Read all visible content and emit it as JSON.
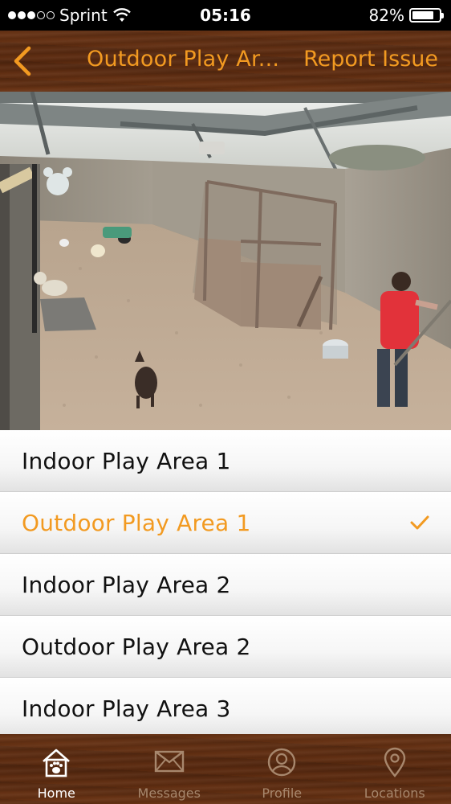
{
  "status_bar": {
    "carrier": "Sprint",
    "time": "05:16",
    "battery": "82%",
    "battery_level": 0.82
  },
  "nav": {
    "title": "Outdoor Play Ar...",
    "report_label": "Report Issue",
    "accent_color": "#f29a21"
  },
  "areas": [
    {
      "label": "Indoor Play Area 1",
      "selected": false
    },
    {
      "label": "Outdoor Play Area 1",
      "selected": true
    },
    {
      "label": "Indoor Play Area 2",
      "selected": false
    },
    {
      "label": "Outdoor Play Area 2",
      "selected": false
    },
    {
      "label": "Indoor Play Area 3",
      "selected": false
    }
  ],
  "tabs": [
    {
      "label": "Home",
      "icon": "home-paw-icon",
      "active": true
    },
    {
      "label": "Messages",
      "icon": "envelope-icon",
      "active": false
    },
    {
      "label": "Profile",
      "icon": "user-icon",
      "active": false
    },
    {
      "label": "Locations",
      "icon": "location-pin-icon",
      "active": false
    }
  ]
}
